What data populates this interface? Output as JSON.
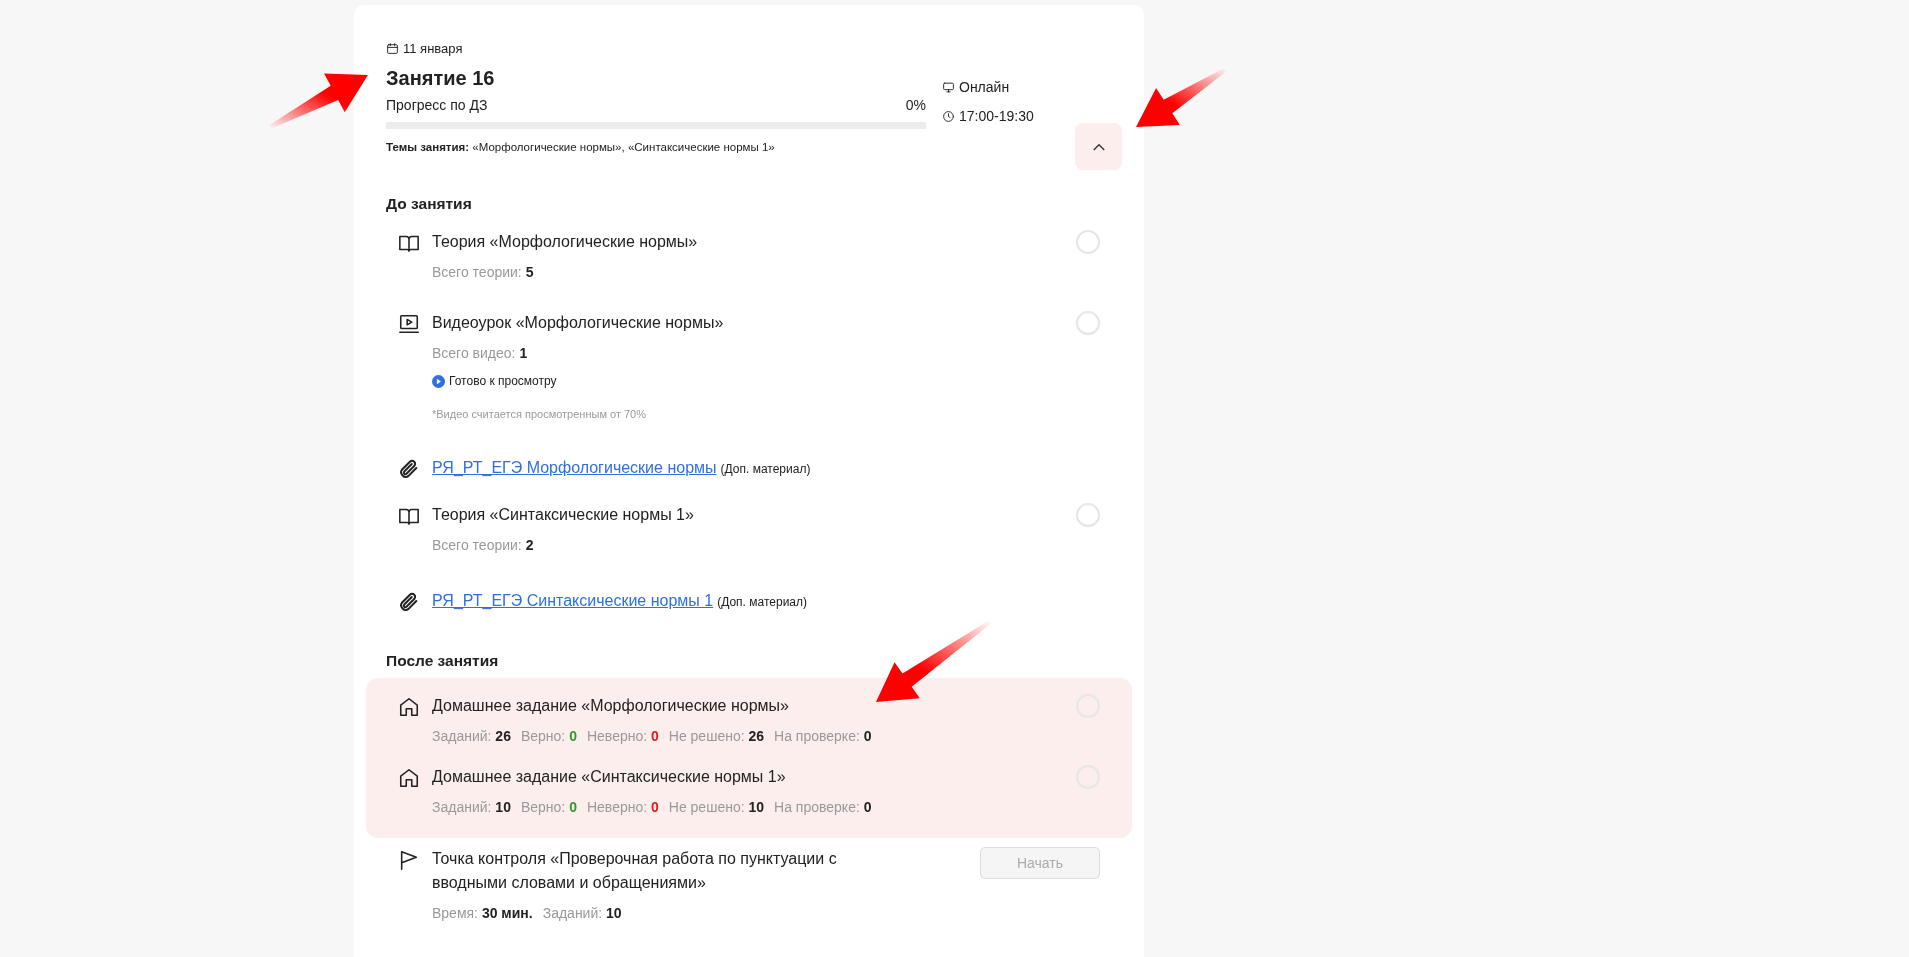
{
  "date": "11 января",
  "lesson": {
    "title": "Занятие 16",
    "progress_label": "Прогресс по ДЗ",
    "progress_value": "0%",
    "level": 0,
    "topics_label": "Темы занятия:",
    "topics": "«Морфологические нормы», «Синтаксические нормы 1»"
  },
  "format": "Онлайн",
  "time": "17:00-19:30",
  "expanded": true,
  "sections": [
    {
      "title": "До занятия",
      "items": [
        {
          "kind": "theory",
          "title": "Теория «Морфологические нормы»",
          "done": false,
          "stats": [
            {
              "label": "Всего теории:",
              "value": "5"
            }
          ]
        },
        {
          "kind": "video",
          "title": "Видеоурок «Морфологические нормы»",
          "done": false,
          "stats": [
            {
              "label": "Всего видео:",
              "value": "1"
            }
          ],
          "status": "Готово к просмотру",
          "note": "*Видео считается просмотренным от 70%"
        },
        {
          "kind": "material",
          "link": "РЯ_РТ_ЕГЭ Морфологические нормы",
          "suffix": "(Доп. материал)"
        },
        {
          "kind": "theory",
          "title": "Теория «Синтаксические нормы 1»",
          "done": false,
          "stats": [
            {
              "label": "Всего теории:",
              "value": "2"
            }
          ]
        },
        {
          "kind": "material",
          "link": "РЯ_РТ_ЕГЭ Синтаксические нормы 1",
          "suffix": "(Доп. материал)"
        }
      ]
    },
    {
      "title": "После занятия",
      "items": [
        {
          "kind": "homework",
          "title": "Домашнее задание «Морфологические нормы»",
          "done": false,
          "highlighted": true,
          "stats": [
            {
              "label": "Заданий:",
              "value": "26"
            },
            {
              "label": "Верно:",
              "value": "0",
              "color": "#2e9a2e"
            },
            {
              "label": "Неверно:",
              "value": "0",
              "color": "#e01b1b"
            },
            {
              "label": "Не решено:",
              "value": "26"
            },
            {
              "label": "На проверке:",
              "value": "0"
            }
          ]
        },
        {
          "kind": "homework",
          "title": "Домашнее задание «Синтаксические нормы 1»",
          "done": false,
          "highlighted": true,
          "stats": [
            {
              "label": "Заданий:",
              "value": "10"
            },
            {
              "label": "Верно:",
              "value": "0",
              "color": "#2e9a2e"
            },
            {
              "label": "Неверно:",
              "value": "0",
              "color": "#e01b1b"
            },
            {
              "label": "Не решено:",
              "value": "10"
            },
            {
              "label": "На проверке:",
              "value": "0"
            }
          ]
        },
        {
          "kind": "checkpoint",
          "title": "Точка контроля «Проверочная работа по пунктуации с вводными словами и обращениями»",
          "highlighted": false,
          "button": {
            "label": "Начать",
            "disabled": true
          },
          "stats": [
            {
              "label": "Время:",
              "value": "30 мин."
            },
            {
              "label": "Заданий:",
              "value": "10"
            }
          ]
        }
      ]
    }
  ]
}
